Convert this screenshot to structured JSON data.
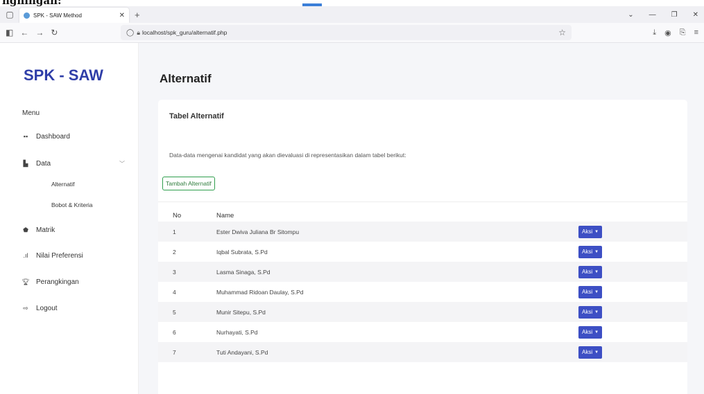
{
  "caption": "nghingan:",
  "browser": {
    "tab_title": "SPK - SAW Method",
    "url": "localhost/spk_guru/alternatif.php"
  },
  "sidebar": {
    "brand": "SPK - SAW",
    "menu_title": "Menu",
    "items": [
      {
        "label": "Dashboard",
        "icon": "grid-icon"
      },
      {
        "label": "Data",
        "icon": "document-icon"
      },
      {
        "label": "Matrik",
        "icon": "pentagon-icon"
      },
      {
        "label": "Nilai Preferensi",
        "icon": "bar-chart-icon"
      },
      {
        "label": "Perangkingan",
        "icon": "trophy-icon"
      },
      {
        "label": "Logout",
        "icon": "logout-icon"
      }
    ],
    "sub_items": [
      "Alternatif",
      "Bobot & Kriteria"
    ]
  },
  "main": {
    "page_title": "Alternatif",
    "card_title": "Tabel Alternatif",
    "description": "Data-data mengenai kandidat yang akan dievaluasi di representasikan dalam tabel berikut:",
    "add_button": "Tambah Alternatif",
    "table": {
      "headers": [
        "No",
        "Name"
      ],
      "action_label": "Aksi",
      "rows": [
        {
          "no": "1",
          "name": "Ester Dwiva Juliana Br Sitompu"
        },
        {
          "no": "2",
          "name": "Iqbal Subrata, S.Pd"
        },
        {
          "no": "3",
          "name": "Lasma Sinaga, S.Pd"
        },
        {
          "no": "4",
          "name": "Muhammad Ridoan Daulay, S.Pd"
        },
        {
          "no": "5",
          "name": "Munir Sitepu, S.Pd"
        },
        {
          "no": "6",
          "name": "Nurhayati, S.Pd"
        },
        {
          "no": "7",
          "name": "Tuti Andayani, S.Pd"
        }
      ]
    }
  },
  "colors": {
    "brand": "#2f3ea8",
    "action_button": "#3d4fc4",
    "add_button_border": "#2f9e4d"
  }
}
